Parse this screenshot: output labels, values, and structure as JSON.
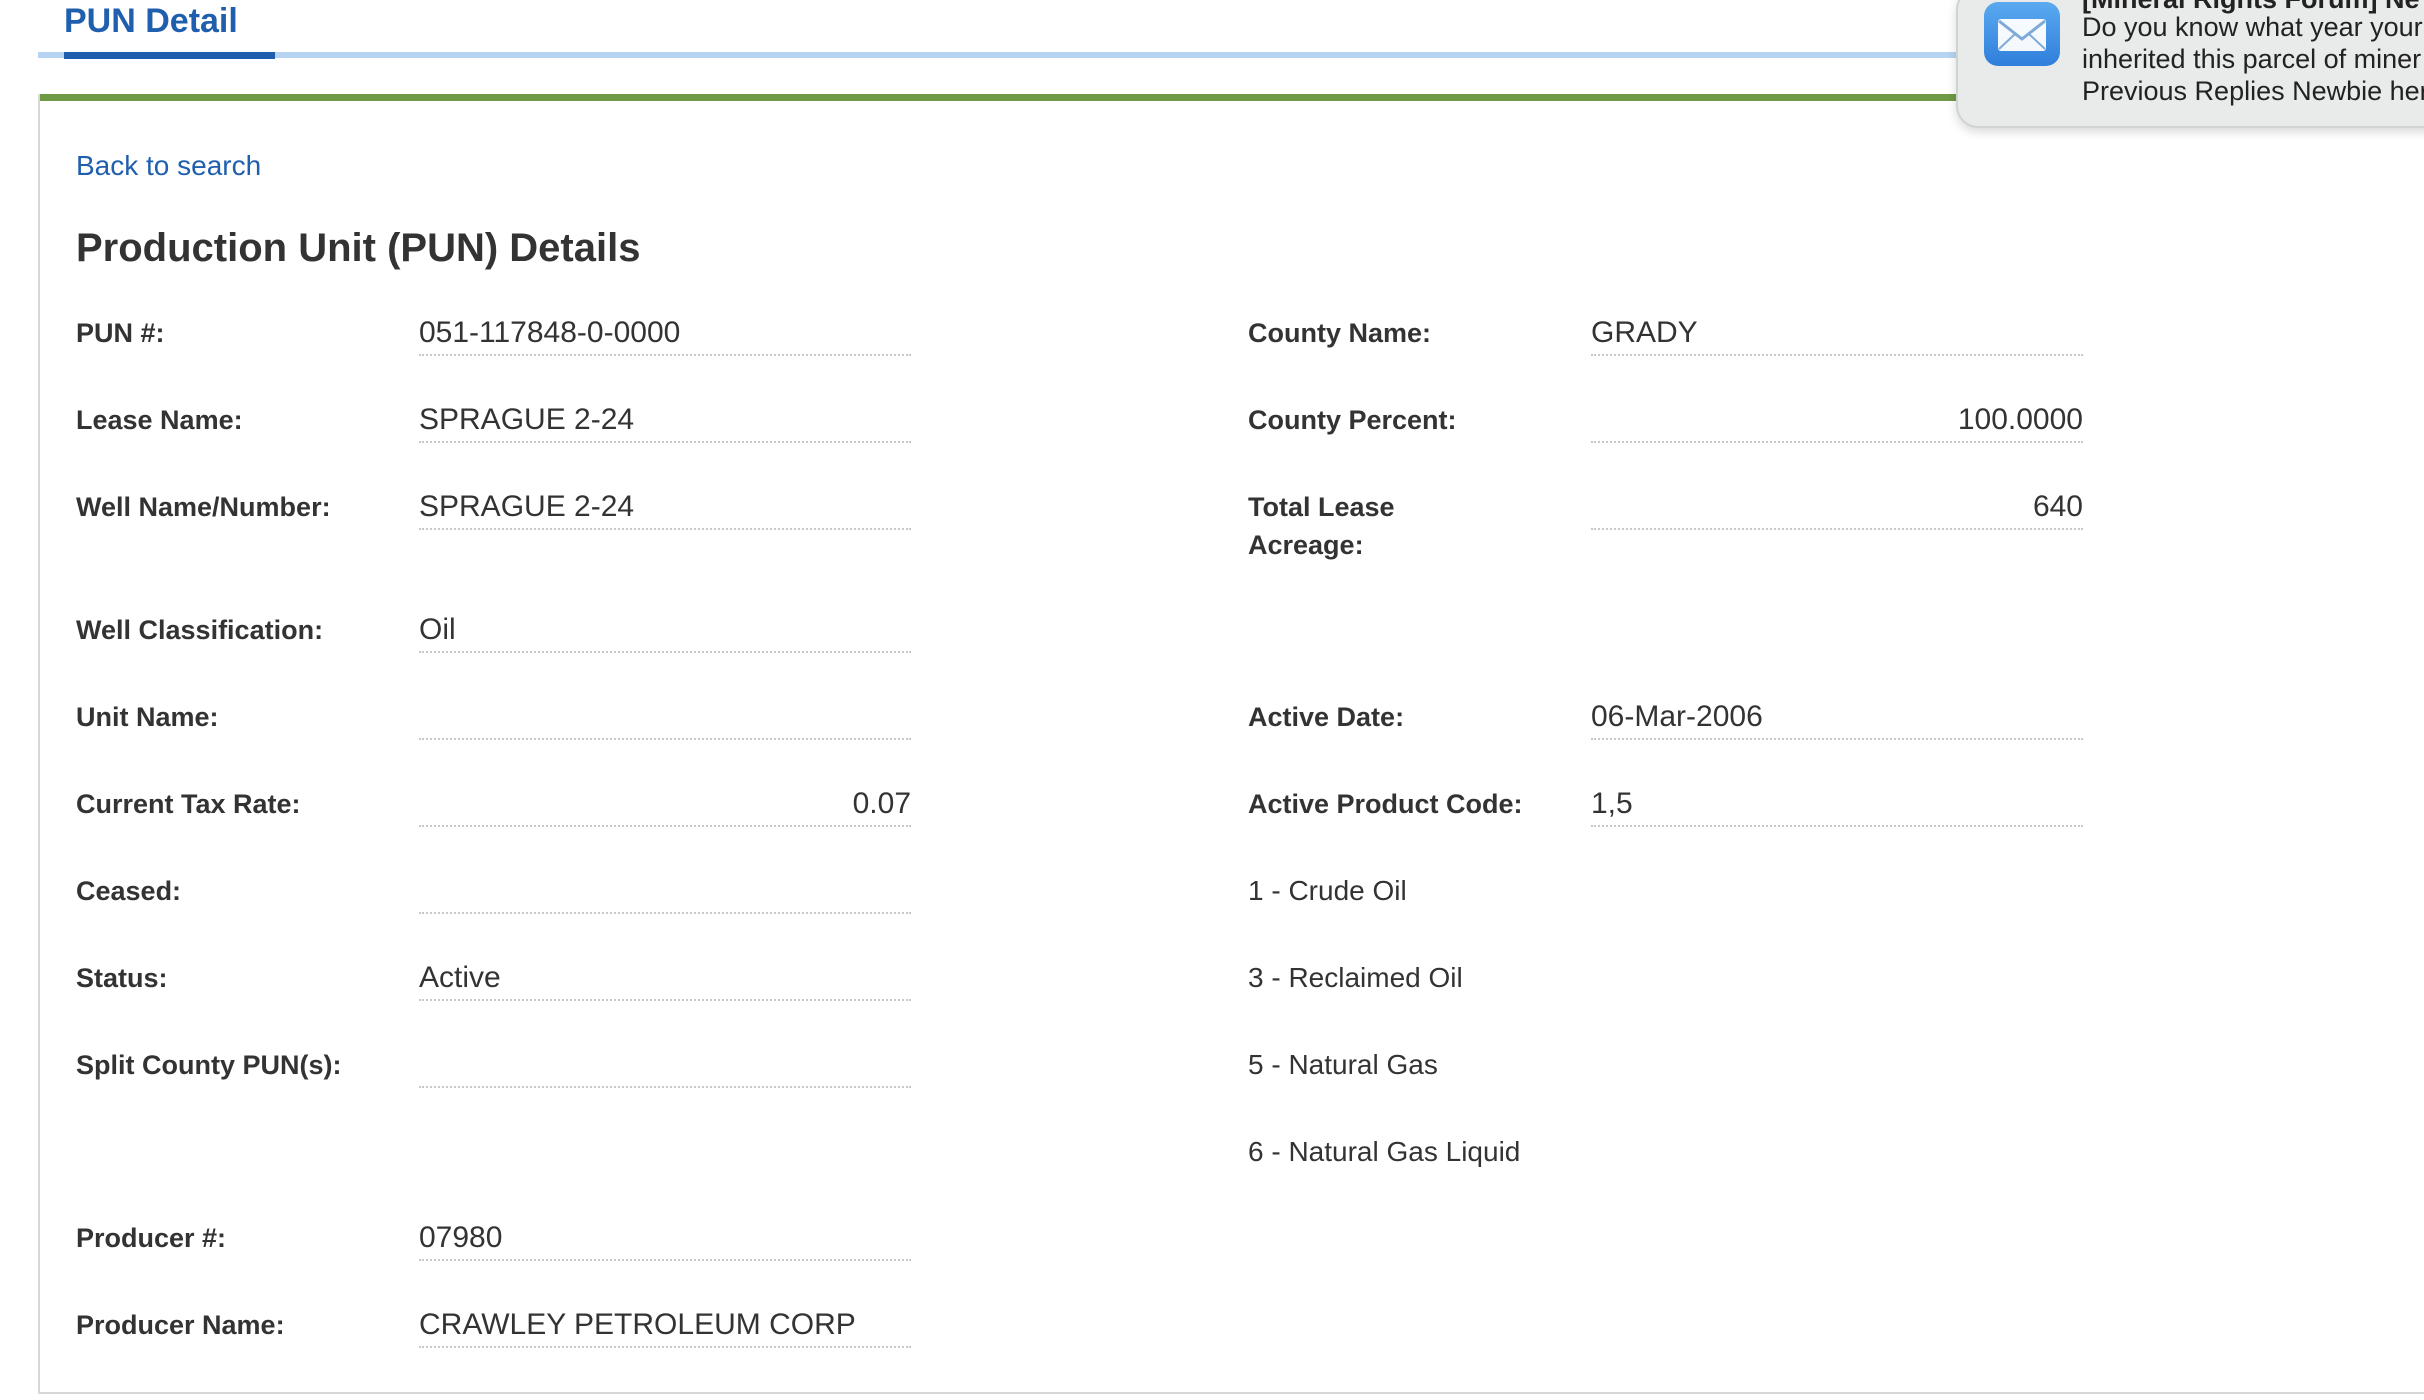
{
  "tab": {
    "title": "PUN Detail"
  },
  "back_link": "Back to search",
  "section_title": "Production Unit (PUN) Details",
  "fields_left": [
    {
      "label": "PUN #:",
      "value": "051-117848-0-0000"
    },
    {
      "label": "Lease Name:",
      "value": "SPRAGUE 2-24"
    },
    {
      "label": "Well Name/Number:",
      "value": "SPRAGUE 2-24"
    },
    {
      "label": "Well Classification:",
      "value": "Oil"
    },
    {
      "label": "Unit Name:",
      "value": ""
    },
    {
      "label": "Current Tax Rate:",
      "value": "0.07"
    },
    {
      "label": "Ceased:",
      "value": ""
    },
    {
      "label": "Status:",
      "value": "Active"
    },
    {
      "label": "Split County PUN(s):",
      "value": ""
    },
    {
      "label": "Producer #:",
      "value": "07980"
    },
    {
      "label": "Producer Name:",
      "value": "CRAWLEY PETROLEUM CORP"
    }
  ],
  "fields_right": [
    {
      "label": "County Name:",
      "value": "GRADY"
    },
    {
      "label": "County Percent:",
      "value": "100.0000"
    },
    {
      "label_line1": "Total Lease",
      "label_line2": "Acreage:",
      "value": "640"
    },
    {
      "label": "Active Date:",
      "value": "06-Mar-2006"
    },
    {
      "label": "Active Product Code:",
      "value": "1,5"
    }
  ],
  "product_codes": [
    "1 - Crude Oil",
    "3 - Reclaimed Oil",
    "5 - Natural Gas",
    "6 - Natural Gas Liquid"
  ],
  "notification": {
    "title": "[Mineral Rights Forum] Ne",
    "line1": "Do you know what year your",
    "line2": "inherited this parcel of miner",
    "line3": "Previous Replies Newbie her"
  }
}
